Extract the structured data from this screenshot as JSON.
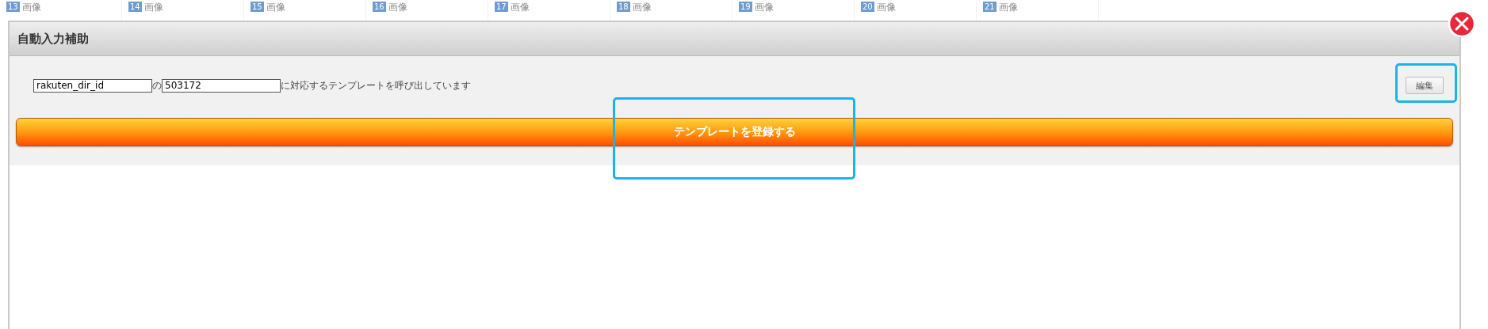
{
  "background_tiles": [
    {
      "number": "13",
      "label": "画像"
    },
    {
      "number": "14",
      "label": "画像"
    },
    {
      "number": "15",
      "label": "画像"
    },
    {
      "number": "16",
      "label": "画像"
    },
    {
      "number": "17",
      "label": "画像"
    },
    {
      "number": "18",
      "label": "画像"
    },
    {
      "number": "19",
      "label": "画像"
    },
    {
      "number": "20",
      "label": "画像"
    },
    {
      "number": "21",
      "label": "画像"
    }
  ],
  "dialog": {
    "title": "自動入力補助",
    "field_name": {
      "value": "rakuten_dir_id"
    },
    "connector": "の",
    "field_value": {
      "value": "503172"
    },
    "message": "に対応するテンプレートを呼び出しています",
    "edit_button": {
      "label": "編集",
      "highlighted": true
    },
    "register_button": {
      "label": "テンプレートを登録する",
      "highlighted": true
    }
  }
}
